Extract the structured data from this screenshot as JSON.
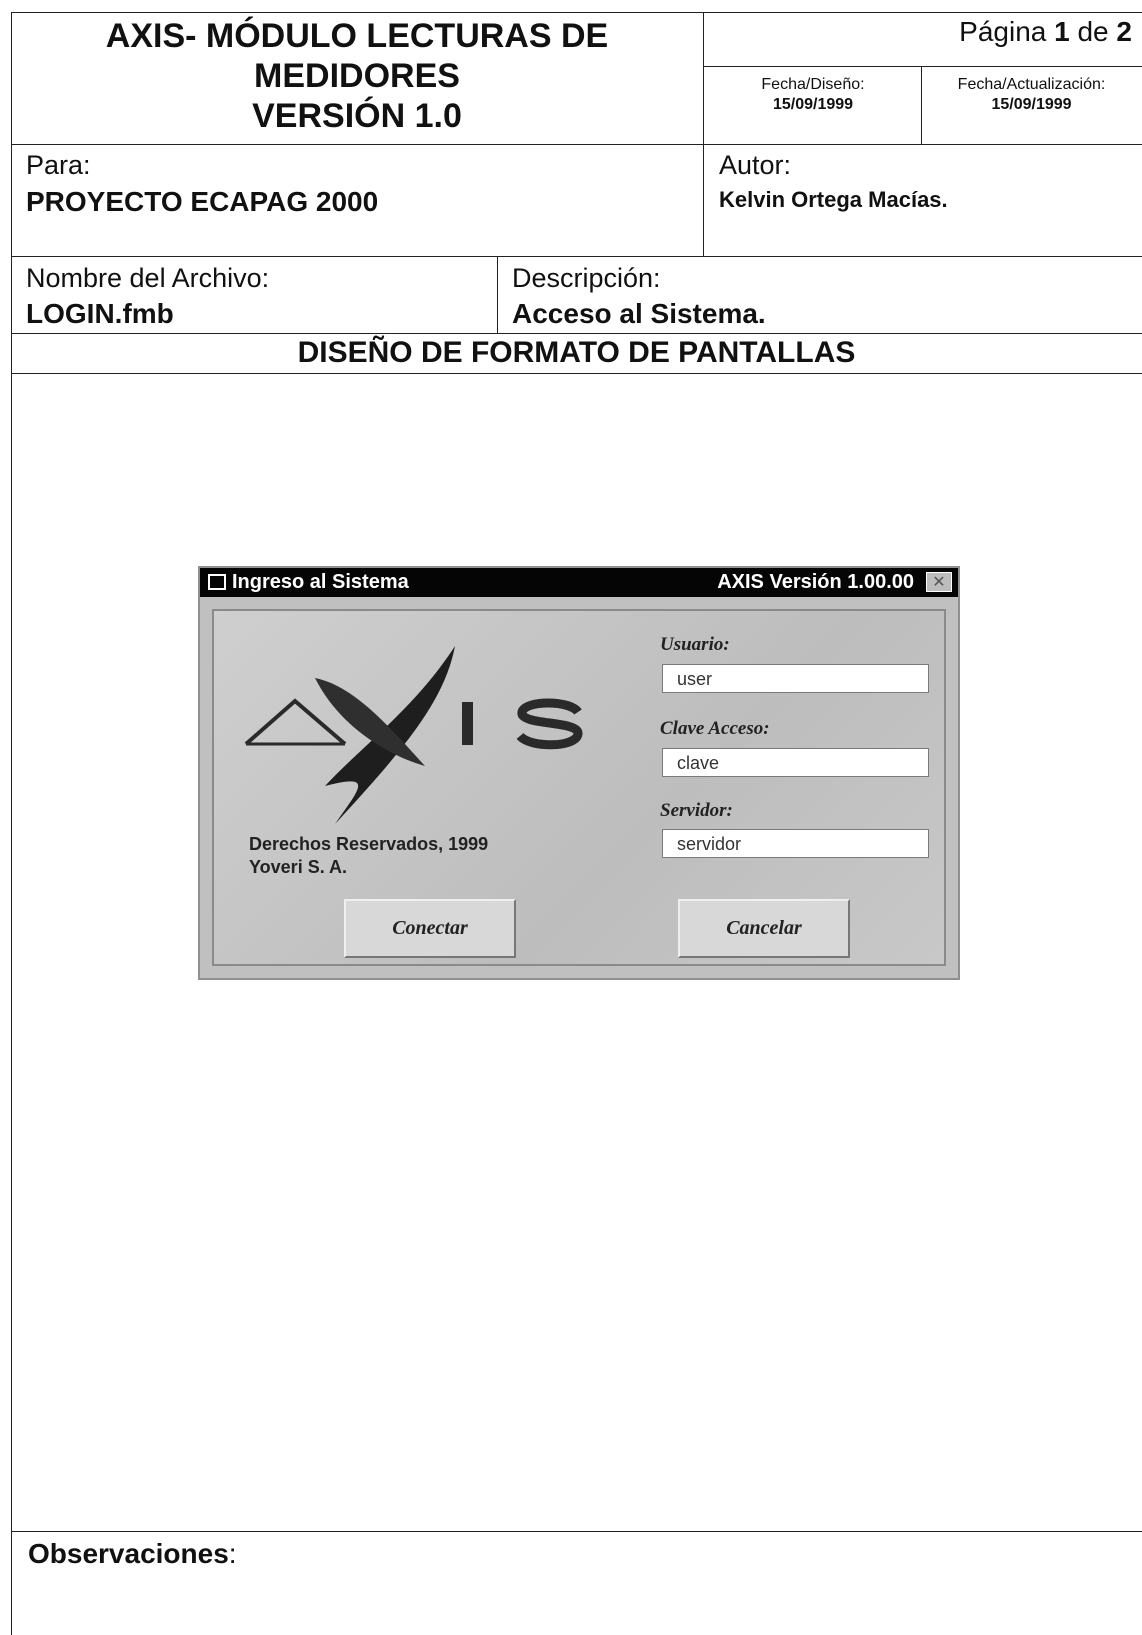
{
  "header": {
    "title_line1": "AXIS- MÓDULO  LECTURAS DE",
    "title_line2": "MEDIDORES",
    "title_line3": "VERSIÓN 1.0",
    "page_prefix": "Página",
    "page_current": "1",
    "page_separator": "de",
    "page_total": "2",
    "fecha_diseno_label": "Fecha/Diseño:",
    "fecha_diseno_value": "15/09/1999",
    "fecha_actualizacion_label": "Fecha/Actualización:",
    "fecha_actualizacion_value": "15/09/1999"
  },
  "info": {
    "para_label": "Para:",
    "para_value": "PROYECTO ECAPAG 2000",
    "autor_label": "Autor:",
    "autor_value": "Kelvin Ortega Macías.",
    "archivo_label": "Nombre del Archivo:",
    "archivo_value": "LOGIN.fmb",
    "descripcion_label": "Descripción:",
    "descripcion_value": "Acceso al Sistema."
  },
  "section_title": "DISEÑO DE FORMATO DE PANTALLAS",
  "dialog": {
    "title": "Ingreso al Sistema",
    "version": "AXIS Versión 1.00.00",
    "logo_text": "AXIS",
    "usuario_label": "Usuario:",
    "usuario_value": "user",
    "clave_label": "Clave Acceso:",
    "clave_value": "clave",
    "servidor_label": "Servidor:",
    "servidor_value": "servidor",
    "copyright_line1": "Derechos Reservados, 1999",
    "copyright_line2": "Yoveri S. A.",
    "conectar_label": "Conectar",
    "cancelar_label": "Cancelar",
    "icons": {
      "app": "app-icon",
      "close": "close-icon"
    }
  },
  "footer": {
    "observaciones_label": "Observaciones",
    "observaciones_colon": ":"
  }
}
